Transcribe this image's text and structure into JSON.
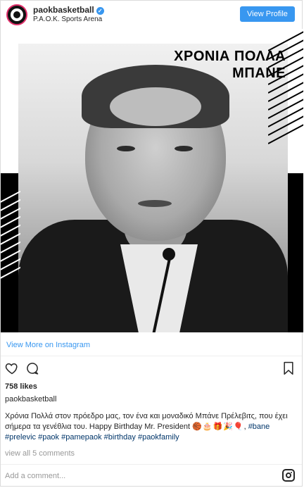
{
  "header": {
    "username": "paokbasketball",
    "verified_badge": "✓",
    "location": "P.A.O.K. Sports Arena",
    "view_profile_label": "View Profile"
  },
  "media": {
    "greeting_line1": "ΧΡΟΝΙΑ ΠΟΛΛΑ",
    "greeting_line2": "ΜΠΑΝΕ"
  },
  "view_more_label": "View More on Instagram",
  "actions": {
    "icons": [
      "heart-icon",
      "comment-icon",
      "bookmark-icon"
    ]
  },
  "likes_text": "758 likes",
  "caption": {
    "username": "paokbasketball",
    "text": "Χρόνια Πολλά στον πρόεδρο μας, τον ένα και μοναδικό Μπάνε Πρέλεβιτς, που έχει σήμερα τα γενέθλια του. Happy Birthday Mr. President",
    "emojis": "🏀🎂🎁🎉🎈",
    "hashtag_bane": "#bane",
    "hashtags_line2": "#prelevic #paok #pamepaok #birthday #paokfamily"
  },
  "view_comments_label": "view all 5 comments",
  "add_comment_placeholder": "Add a comment...",
  "colors": {
    "accent_blue": "#3897f0",
    "hashtag": "#003569",
    "muted": "#999999"
  }
}
